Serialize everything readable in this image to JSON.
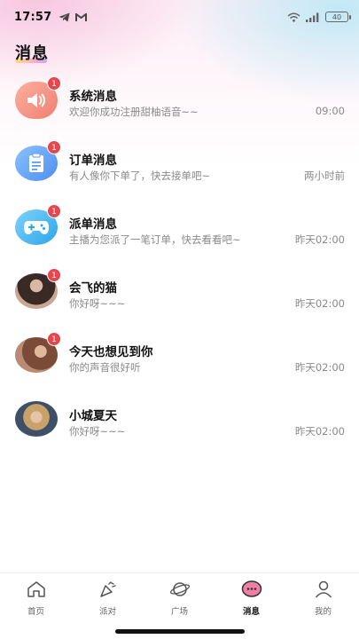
{
  "status_bar": {
    "time": "17:57",
    "battery": "40",
    "left_icons": [
      "telegram-icon",
      "gmail-icon"
    ],
    "right_icons": [
      "wifi-icon",
      "signal-icon",
      "battery-icon"
    ]
  },
  "header": {
    "title": "消息"
  },
  "messages": [
    {
      "avatar": "speaker-icon",
      "badge": "1",
      "title": "系统消息",
      "subtitle": "欢迎你成功注册甜柚语音~~",
      "time": "09:00",
      "color": "#f58f78"
    },
    {
      "avatar": "clipboard-icon",
      "badge": "1",
      "title": "订单消息",
      "subtitle": "有人像你下单了，快去接单吧~",
      "time": "两小时前",
      "color": "#5b9cf5"
    },
    {
      "avatar": "gamepad-icon",
      "badge": "1",
      "title": "派单消息",
      "subtitle": "主播为您派了一笔订单，快去看看吧~",
      "time": "昨天02:00",
      "color": "#45b5f0"
    },
    {
      "avatar": "user-photo",
      "badge": "1",
      "title": "会飞的猫",
      "subtitle": "你好呀~~~",
      "time": "昨天02:00"
    },
    {
      "avatar": "user-photo",
      "badge": "1",
      "title": "今天也想见到你",
      "subtitle": "你的声音很好听",
      "time": "昨天02:00"
    },
    {
      "avatar": "user-photo",
      "badge": "",
      "title": "小城夏天",
      "subtitle": "你好呀~~~",
      "time": "昨天02:00"
    }
  ],
  "tabbar": {
    "tabs": [
      {
        "label": "首页",
        "icon": "home-icon",
        "active": false
      },
      {
        "label": "派对",
        "icon": "party-icon",
        "active": false
      },
      {
        "label": "广场",
        "icon": "planet-icon",
        "active": false
      },
      {
        "label": "消息",
        "icon": "chat-bubble-icon",
        "active": true
      },
      {
        "label": "我的",
        "icon": "person-icon",
        "active": false
      }
    ]
  },
  "colors": {
    "accent": "#e5474e",
    "active_tab": "#f07fa6"
  }
}
